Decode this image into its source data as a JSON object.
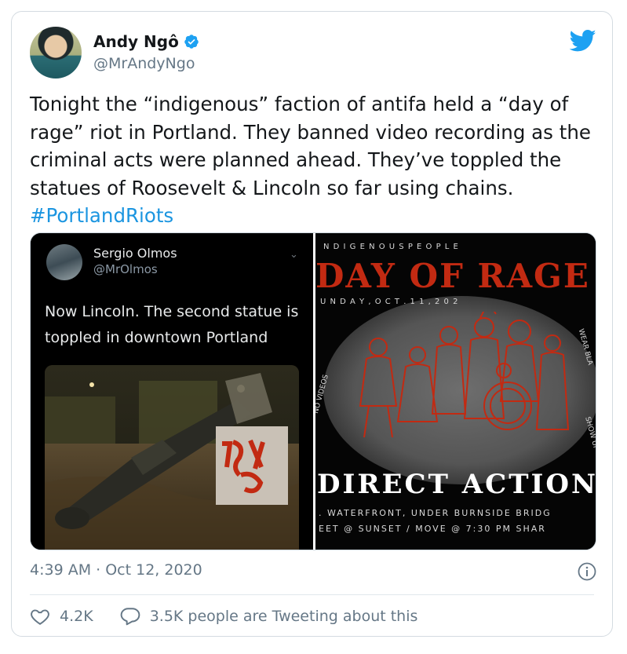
{
  "author": {
    "name": "Andy Ngô",
    "handle": "@MrAndyNgo"
  },
  "tweet": {
    "text_main": "Tonight the “indigenous” faction of antifa held a “day of rage” riot in Portland. They banned video recording as the criminal acts were planned ahead. They’ve toppled the statues of Roosevelt & Lincoln so far using chains. ",
    "hashtag": "#PortlandRiots"
  },
  "embedded": {
    "name": "Sergio Olmos",
    "handle": "@MrOlmos",
    "text": "Now Lincoln. The second statue is toppled in downtown Portland"
  },
  "poster": {
    "line1": "N D I G E N O U S    P E O P L E",
    "title": "DAY OF RAGE",
    "date": "U N D A Y ,   O C T .   1 1 ,   2 0 2",
    "left_side": "NO VIDEOS",
    "right_side_top": "WEAR BLA",
    "right_side_bottom": "SHOW UP",
    "action": "DIRECT ACTION",
    "info1": ". WATERFRONT, UNDER BURNSIDE BRIDG",
    "info2": "EET @ SUNSET / MOVE @ 7:30 PM SHAR"
  },
  "footer": {
    "timestamp": "4:39 AM · Oct 12, 2020",
    "likes": "4.2K",
    "tweeting": "3.5K people are Tweeting about this"
  },
  "colors": {
    "link": "#1b95e0",
    "verified": "#1da1f2",
    "twitter_bird": "#1da1f2",
    "muted": "#657786",
    "poster_red": "#c22a12"
  }
}
